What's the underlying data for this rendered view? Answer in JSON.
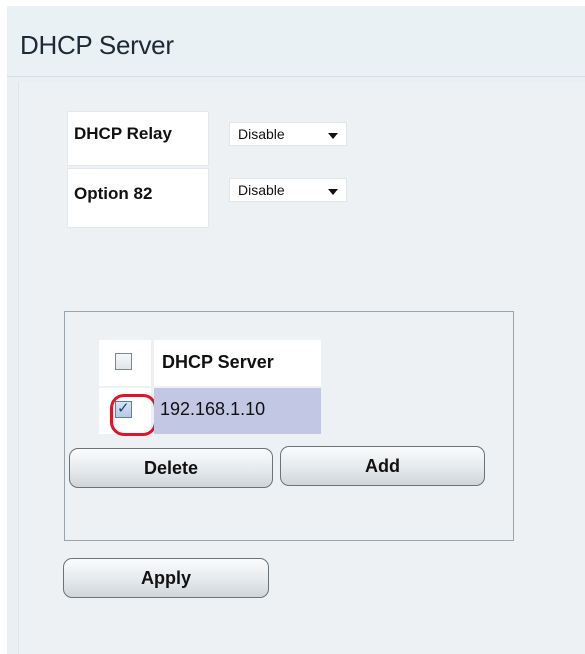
{
  "page": {
    "title": "DHCP Server"
  },
  "settings": {
    "relay": {
      "label": "DHCP Relay",
      "value": "Disable"
    },
    "option82": {
      "label": "Option 82",
      "value": "Disable"
    }
  },
  "server_table": {
    "header": "DHCP Server",
    "rows": [
      {
        "address": "192.168.1.10",
        "checked": true
      }
    ]
  },
  "buttons": {
    "delete": "Delete",
    "add": "Add",
    "apply": "Apply"
  },
  "colors": {
    "selected_row": "#c2c7e4",
    "highlight_ring": "#e0132a"
  }
}
